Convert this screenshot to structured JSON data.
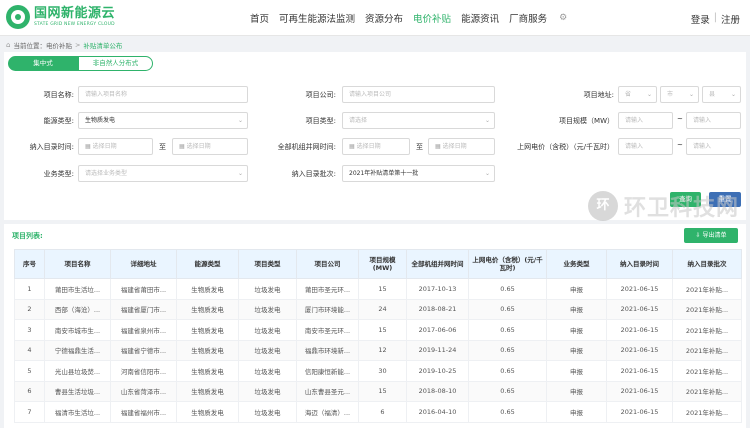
{
  "header": {
    "logo_cn": "国网新能源云",
    "logo_en": "STATE GRID NEW ENERGY CLOUD",
    "nav": [
      "首页",
      "可再生能源法监测",
      "资源分布",
      "电价补贴",
      "能源资讯",
      "厂商服务"
    ],
    "active_nav": "电价补贴",
    "login": "登录",
    "separator": "|",
    "register": "注册"
  },
  "breadcrumb": {
    "prefix": "当前位置：",
    "level1": "电价补贴",
    "level2": "补贴清单公布"
  },
  "tabs": {
    "tab1": "集中式",
    "tab2": "非自然人分布式"
  },
  "form": {
    "project_name_label": "项目名称:",
    "project_name_placeholder": "请输入项目名称",
    "project_company_label": "项目公司:",
    "project_company_placeholder": "请输入项目公司",
    "project_address_label": "项目地址:",
    "province": "省",
    "city": "市",
    "county": "县",
    "energy_type_label": "能源类型:",
    "energy_type_value": "生物质发电",
    "project_type_label": "项目类型:",
    "project_type_placeholder": "请选择",
    "project_scale_label": "项目规模（MW）",
    "range_placeholder": "请输入",
    "catalog_time_label": "纳入目录时间:",
    "date_placeholder": "选择日期",
    "to_label": "至",
    "grid_time_label": "全部机组并网时间:",
    "price_label": "上网电价（含税）（元/千瓦时）",
    "business_type_label": "业务类型:",
    "business_type_placeholder": "请选择业务类型",
    "catalog_batch_label": "纳入目录批次:",
    "catalog_batch_value": "2021年补贴清单第十一批",
    "search_button": "查询",
    "reset_button": "重置"
  },
  "list": {
    "title": "项目列表:",
    "export_button": "导出清单",
    "columns": [
      "序号",
      "项目名称",
      "详细地址",
      "能源类型",
      "项目类型",
      "项目公司",
      "项目规模(MW)",
      "全部机组并网时间",
      "上网电价（含税）(元/千瓦时)",
      "业务类型",
      "纳入目录时间",
      "纳入目录批次"
    ],
    "rows": [
      [
        "1",
        "莆田市生活垃...",
        "福建省莆田市...",
        "生物质发电",
        "垃圾发电",
        "莆田市圣元环...",
        "15",
        "2017-10-13",
        "0.65",
        "申报",
        "2021-06-15",
        "2021年补贴..."
      ],
      [
        "2",
        "西部（海沧）...",
        "福建省厦门市...",
        "生物质发电",
        "垃圾发电",
        "厦门市环境能...",
        "24",
        "2018-08-21",
        "0.65",
        "申报",
        "2021-06-15",
        "2021年补贴..."
      ],
      [
        "3",
        "南安市城市生...",
        "福建省泉州市...",
        "生物质发电",
        "垃圾发电",
        "南安市圣元环...",
        "15",
        "2017-06-06",
        "0.65",
        "申报",
        "2021-06-15",
        "2021年补贴..."
      ],
      [
        "4",
        "宁德福鼎生活...",
        "福建省宁德市...",
        "生物质发电",
        "垃圾发电",
        "福鼎市环境新...",
        "12",
        "2019-11-24",
        "0.65",
        "申报",
        "2021-06-15",
        "2021年补贴..."
      ],
      [
        "5",
        "光山县垃圾焚...",
        "河南省信阳市...",
        "生物质发电",
        "垃圾发电",
        "信阳康恒新能...",
        "30",
        "2019-10-25",
        "0.65",
        "申报",
        "2021-06-15",
        "2021年补贴..."
      ],
      [
        "6",
        "曹县生活垃圾...",
        "山东省菏泽市...",
        "生物质发电",
        "垃圾发电",
        "山东曹县圣元...",
        "15",
        "2018-08-10",
        "0.65",
        "申报",
        "2021-06-15",
        "2021年补贴..."
      ],
      [
        "7",
        "福清市生活垃...",
        "福建省福州市...",
        "生物质发电",
        "垃圾发电",
        "海迈（福清）...",
        "6",
        "2016-04-10",
        "0.65",
        "申报",
        "2021-06-15",
        "2021年补贴..."
      ]
    ]
  },
  "watermark": {
    "badge": "环",
    "text": "环卫科技网"
  }
}
